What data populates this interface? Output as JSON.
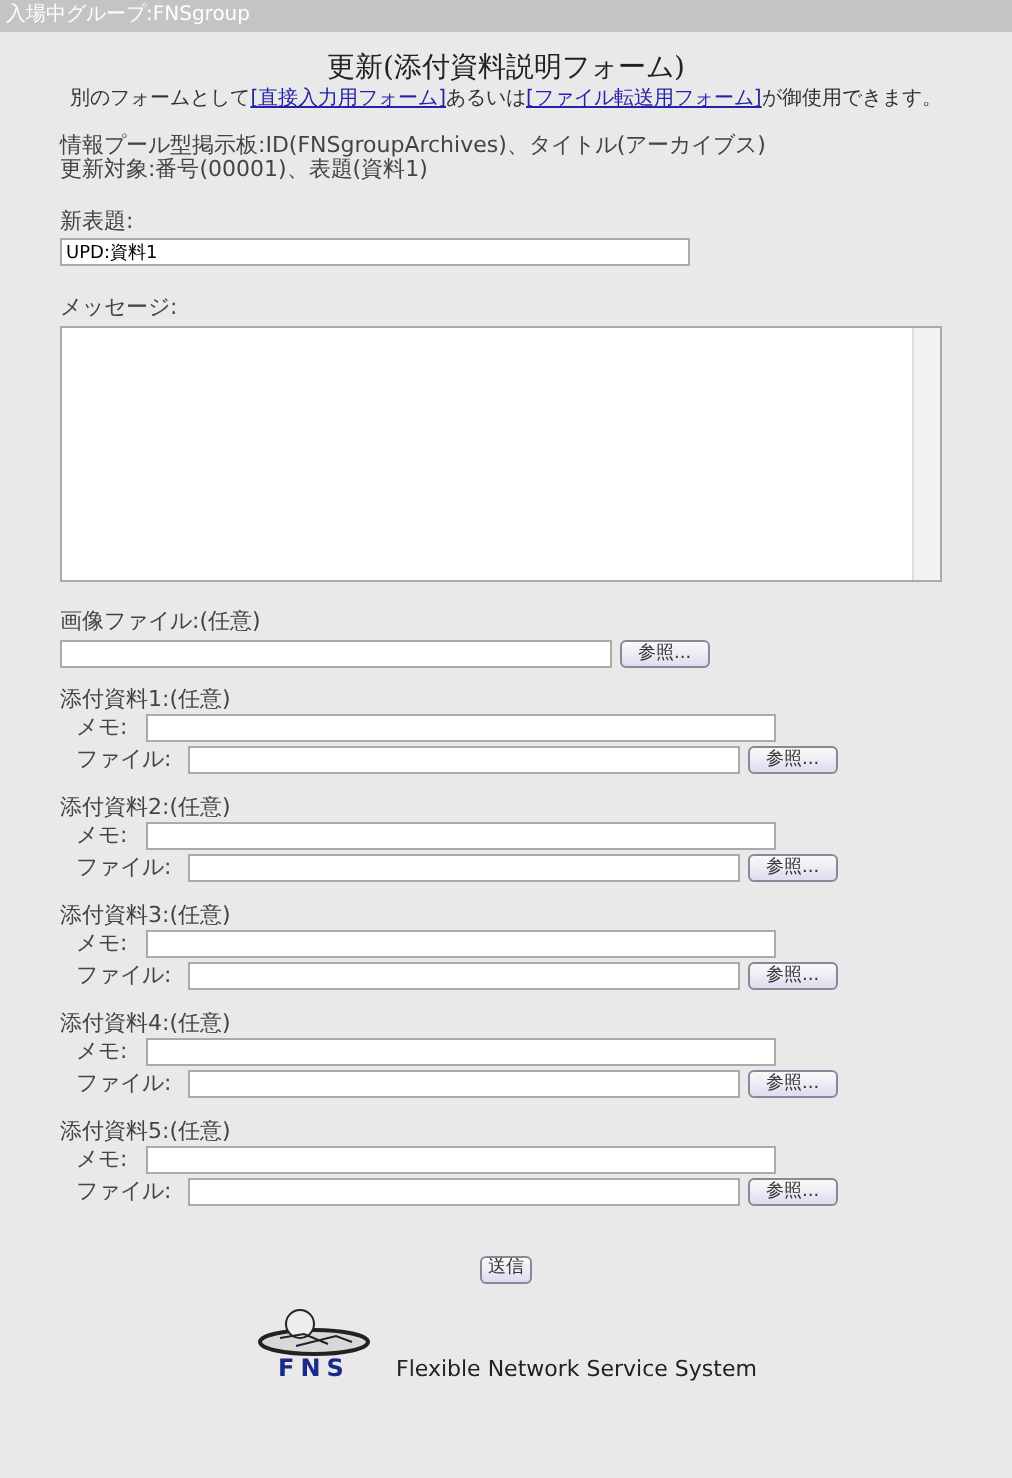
{
  "header": {
    "text": "入場中グループ:FNSgroup"
  },
  "title": "更新(添付資料説明フォーム)",
  "note": [
    {
      "kind": "text",
      "text": "別のフォームとして"
    },
    {
      "kind": "link",
      "text": "[直接入力用フォーム]"
    },
    {
      "kind": "text",
      "text": "あるいは"
    },
    {
      "kind": "link",
      "text": "[ファイル転送用フォーム]"
    },
    {
      "kind": "text",
      "text": "が御使用できます。"
    }
  ],
  "info": [
    "情報プール型掲示板:ID(FNSgroupArchives)、タイトル(アーカイブス)",
    "更新対象:番号(00001)、表題(資料1)"
  ],
  "new_title": {
    "label": "新表題:",
    "value": "UPD:資料1"
  },
  "message": {
    "label": "メッセージ:"
  },
  "image_file": {
    "label": "画像ファイル:(任意)",
    "button": "参照..."
  },
  "attachments": [
    {
      "heading": "添付資料1:(任意)",
      "memo_label": "メモ:",
      "file_label": "ファイル:",
      "button": "参照..."
    },
    {
      "heading": "添付資料2:(任意)",
      "memo_label": "メモ:",
      "file_label": "ファイル:",
      "button": "参照..."
    },
    {
      "heading": "添付資料3:(任意)",
      "memo_label": "メモ:",
      "file_label": "ファイル:",
      "button": "参照..."
    },
    {
      "heading": "添付資料4:(任意)",
      "memo_label": "メモ:",
      "file_label": "ファイル:",
      "button": "参照..."
    },
    {
      "heading": "添付資料5:(任意)",
      "memo_label": "メモ:",
      "file_label": "ファイル:",
      "button": "参照..."
    }
  ],
  "submit": "送信",
  "footer": {
    "logo_text": "FNS",
    "tagline": "Flexible Network Service System"
  }
}
